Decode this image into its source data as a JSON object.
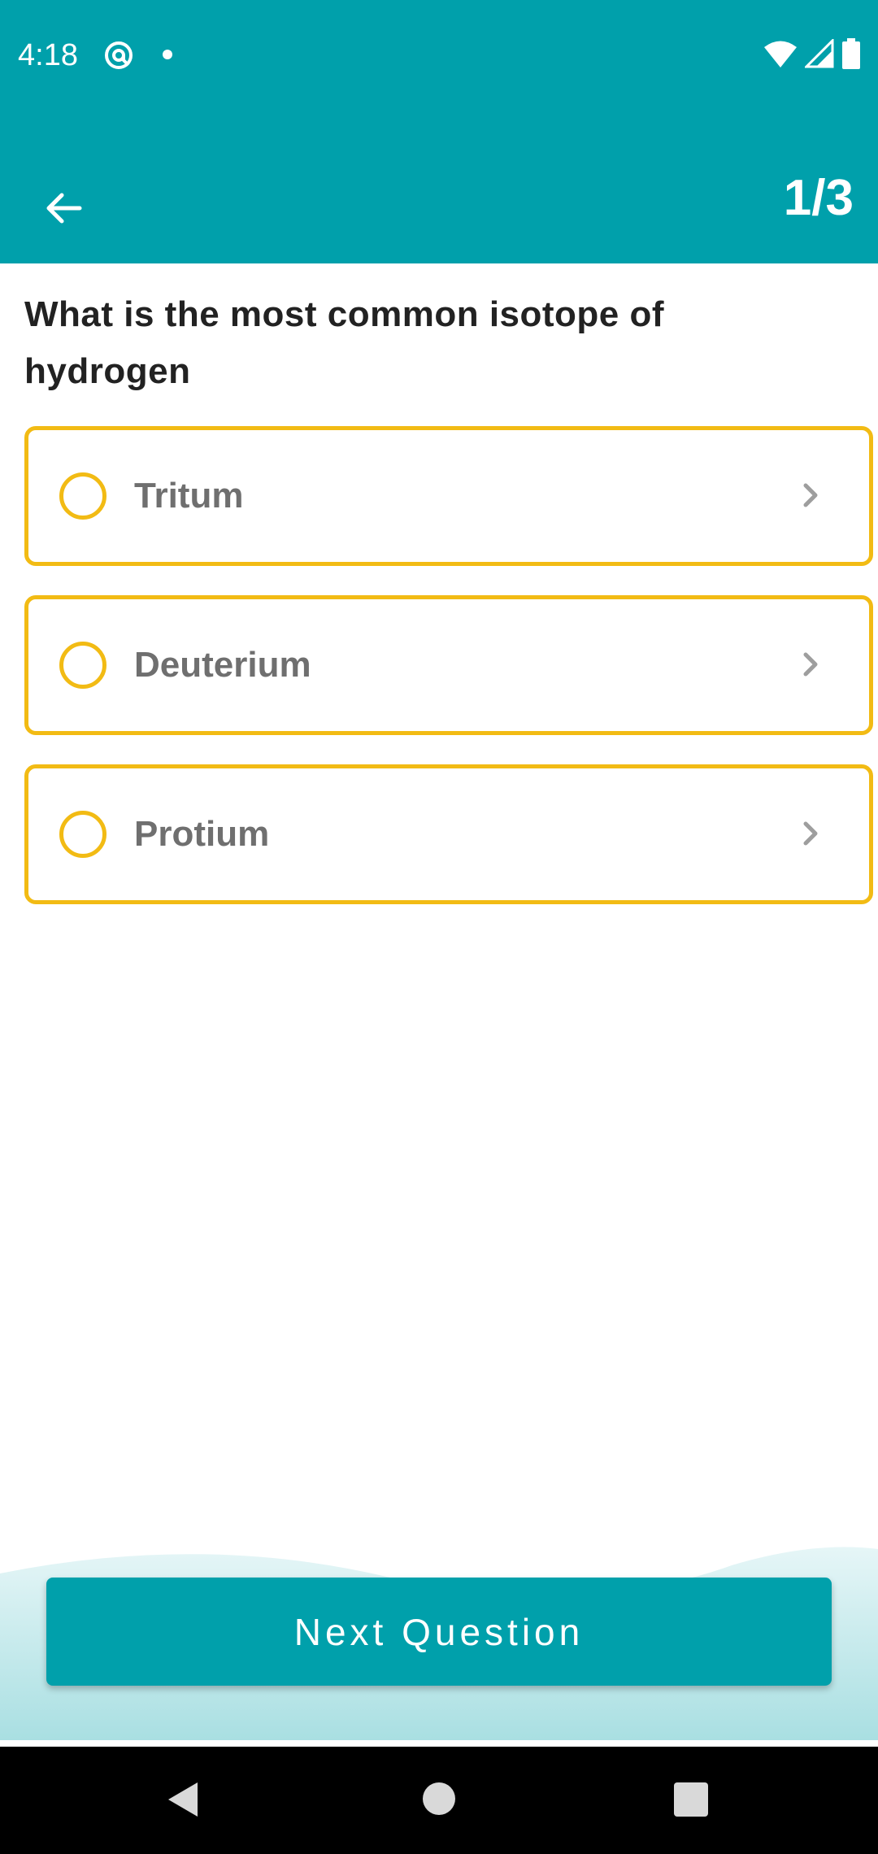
{
  "status_bar": {
    "time": "4:18",
    "icons": [
      "at-sign-icon",
      "notification-dot-icon",
      "wifi-icon",
      "cell-signal-icon",
      "battery-icon"
    ]
  },
  "app_bar": {
    "back_icon": "arrow-left-icon",
    "progress": "1/3",
    "background_color": "#00a0ab"
  },
  "question": {
    "text": "What is the most common isotope of hydrogen"
  },
  "options": [
    {
      "label": "Tritum",
      "selected": false
    },
    {
      "label": "Deuterium",
      "selected": false
    },
    {
      "label": "Protium",
      "selected": false
    }
  ],
  "option_colors": {
    "border": "#f2bb14",
    "label": "#6f6f6f",
    "chevron": "#9e9e9e"
  },
  "footer": {
    "next_label": "Next Question",
    "button_color": "#00a0ab"
  },
  "nav_bar": {
    "icons": [
      "nav-back-icon",
      "nav-home-icon",
      "nav-recents-icon"
    ]
  }
}
